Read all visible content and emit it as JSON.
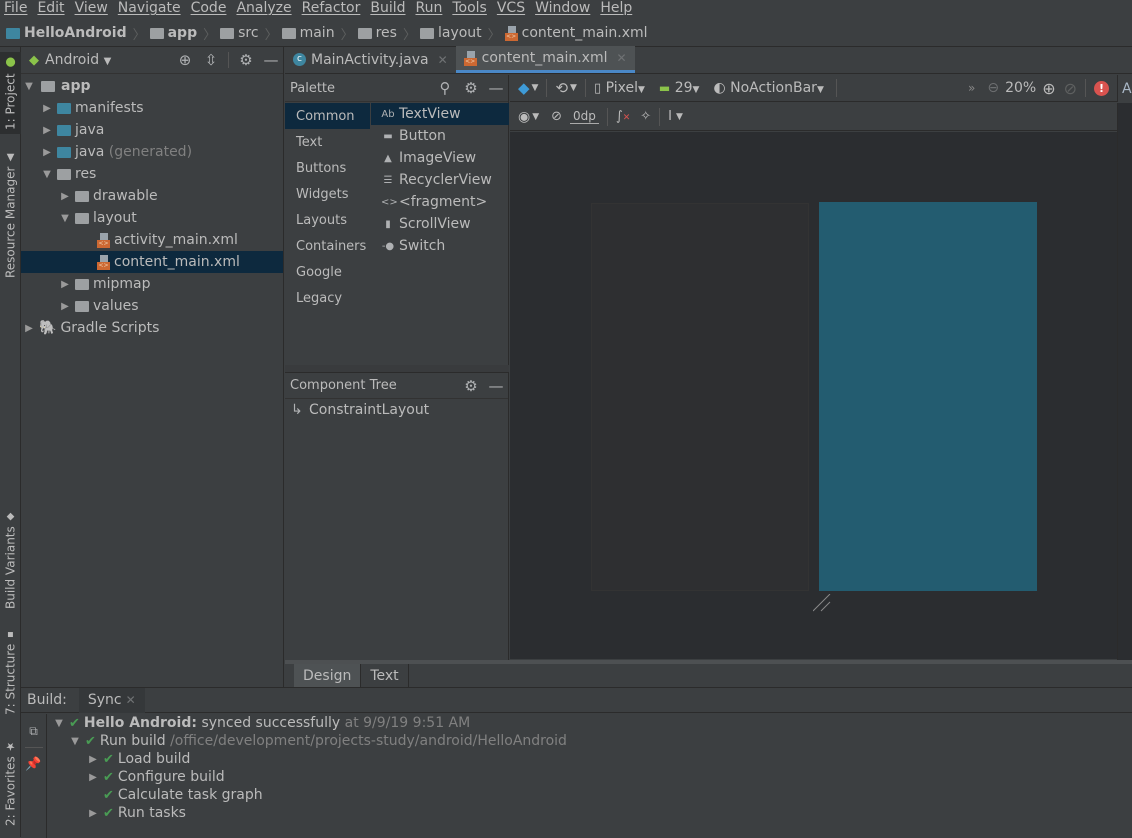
{
  "menu": [
    "File",
    "Edit",
    "View",
    "Navigate",
    "Code",
    "Analyze",
    "Refactor",
    "Build",
    "Run",
    "Tools",
    "VCS",
    "Window",
    "Help"
  ],
  "breadcrumb": [
    "HelloAndroid",
    "app",
    "src",
    "main",
    "res",
    "layout",
    "content_main.xml"
  ],
  "left_stripe": {
    "project": "1: Project",
    "resource_manager": "Resource Manager",
    "build_variants": "Build Variants",
    "structure": "7: Structure",
    "favorites": "2: Favorites"
  },
  "project_panel": {
    "view_selector": "Android",
    "tree": [
      {
        "label": "app",
        "level": 0,
        "expanded": true,
        "bold": true
      },
      {
        "label": "manifests",
        "level": 1,
        "expanded": false
      },
      {
        "label": "java",
        "level": 1,
        "expanded": false
      },
      {
        "label": "java",
        "suffix": "(generated)",
        "level": 1,
        "expanded": false
      },
      {
        "label": "res",
        "level": 1,
        "expanded": true
      },
      {
        "label": "drawable",
        "level": 2,
        "expanded": false
      },
      {
        "label": "layout",
        "level": 2,
        "expanded": true
      },
      {
        "label": "activity_main.xml",
        "level": 3
      },
      {
        "label": "content_main.xml",
        "level": 3,
        "selected": true
      },
      {
        "label": "mipmap",
        "level": 2,
        "expanded": false
      },
      {
        "label": "values",
        "level": 2,
        "expanded": false
      },
      {
        "label": "Gradle Scripts",
        "level": 0,
        "expanded": false
      }
    ]
  },
  "editor_tabs": [
    {
      "label": "MainActivity.java",
      "active": false
    },
    {
      "label": "content_main.xml",
      "active": true
    }
  ],
  "palette": {
    "title": "Palette",
    "categories": [
      "Common",
      "Text",
      "Buttons",
      "Widgets",
      "Layouts",
      "Containers",
      "Google",
      "Legacy"
    ],
    "selected_category": "Common",
    "items": [
      {
        "label": "TextView",
        "icon": "Ab"
      },
      {
        "label": "Button",
        "icon": "▬"
      },
      {
        "label": "ImageView",
        "icon": "▲"
      },
      {
        "label": "RecyclerView",
        "icon": "☰"
      },
      {
        "label": "<fragment>",
        "icon": "<>"
      },
      {
        "label": "ScrollView",
        "icon": "▮"
      },
      {
        "label": "Switch",
        "icon": "-●"
      }
    ]
  },
  "component_tree": {
    "title": "Component Tree",
    "root": "ConstraintLayout"
  },
  "design_toolbar": {
    "device": "Pixel",
    "api": "29",
    "theme": "NoActionBar",
    "zoom": "20%",
    "margin": "0dp",
    "overflow": "»",
    "right_cut": "A"
  },
  "bottom_tabs": [
    {
      "label": "Design",
      "active": true
    },
    {
      "label": "Text",
      "active": false
    }
  ],
  "build": {
    "label": "Build:",
    "tab": "Sync",
    "rows": [
      {
        "level": 0,
        "arrow": "▼",
        "title": "Hello Android:",
        "text": "synced successfully",
        "detail": "at 9/9/19 9:51 AM"
      },
      {
        "level": 1,
        "arrow": "▼",
        "text": "Run build",
        "detail": "/office/development/projects-study/android/HelloAndroid"
      },
      {
        "level": 2,
        "arrow": "▶",
        "text": "Load build"
      },
      {
        "level": 2,
        "arrow": "▶",
        "text": "Configure build"
      },
      {
        "level": 2,
        "arrow": "",
        "text": "Calculate task graph"
      },
      {
        "level": 2,
        "arrow": "▶",
        "text": "Run tasks"
      }
    ]
  },
  "colors": {
    "selection": "#0d293e",
    "blueprint": "#235c70",
    "accent": "#4a88c7",
    "success": "#499c54",
    "error": "#d9534f",
    "android_green": "#8bc34a"
  }
}
